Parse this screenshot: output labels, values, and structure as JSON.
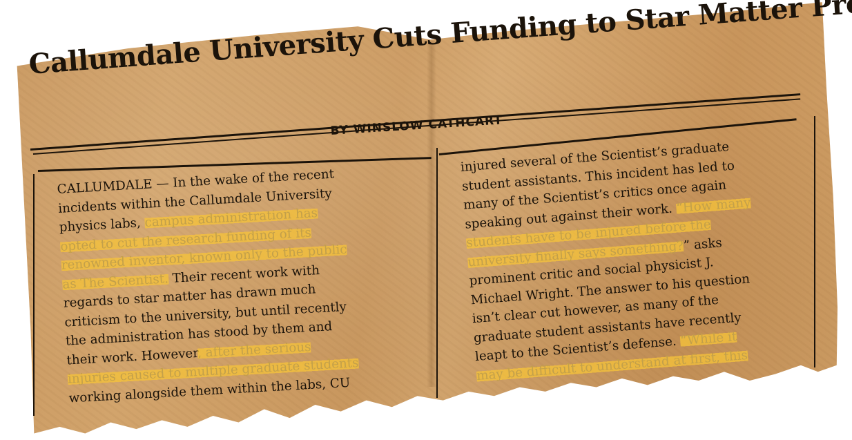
{
  "headline": "Callumdale University Cuts Funding to Star Matter Project",
  "byline": "BY WINSLOW CATHCART",
  "left_column": [
    [
      {
        "t": "CALLUMDALE — In the wake of the recent"
      }
    ],
    [
      {
        "t": "incidents within the Callumdale University"
      }
    ],
    [
      {
        "t": "physics labs, "
      },
      {
        "t": "campus administration has",
        "hl": true
      }
    ],
    [
      {
        "t": "opted to cut the research funding of its",
        "hl": true
      }
    ],
    [
      {
        "t": "renowned inventor, known only to the public",
        "hl": true
      }
    ],
    [
      {
        "t": "as The Scientist.",
        "hl": true
      },
      {
        "t": " Their recent work with"
      }
    ],
    [
      {
        "t": "regards to star matter has drawn much"
      }
    ],
    [
      {
        "t": "criticism to the university, but until recently"
      }
    ],
    [
      {
        "t": "the administration has stood by them and"
      }
    ],
    [
      {
        "t": "their work. However"
      },
      {
        "t": ", after the serious",
        "hl": true
      }
    ],
    [
      {
        "t": "injuries caused to multiple graduate students",
        "hl": true
      }
    ],
    [
      {
        "t": "working alongside them within the labs, CU"
      }
    ]
  ],
  "right_column": [
    [
      {
        "t": "injured several of the Scientist’s graduate"
      }
    ],
    [
      {
        "t": "student assistants. This incident has led to"
      }
    ],
    [
      {
        "t": "many of the Scientist’s critics once again"
      }
    ],
    [
      {
        "t": "speaking out against their work. "
      },
      {
        "t": "“How many",
        "hl": true
      }
    ],
    [
      {
        "t": "students have to be injured before the",
        "hl": true
      }
    ],
    [
      {
        "t": "university finally says something?",
        "hl": true
      },
      {
        "t": "” asks"
      }
    ],
    [
      {
        "t": "prominent critic and social physicist J."
      }
    ],
    [
      {
        "t": "Michael Wright. The answer to his question"
      }
    ],
    [
      {
        "t": "isn’t clear cut however, as many of the"
      }
    ],
    [
      {
        "t": "graduate student assistants have recently"
      }
    ],
    [
      {
        "t": "leapt to the Scientist’s defense. "
      },
      {
        "t": "“While it",
        "hl": true
      }
    ],
    [
      {
        "t": "may be difficult to understand at first, this",
        "hl": true
      }
    ]
  ],
  "colors": {
    "paper": "#cf9f66",
    "ink": "#1b130a",
    "highlight": "#f5c23a",
    "highlight_text": "#c3a04a"
  }
}
